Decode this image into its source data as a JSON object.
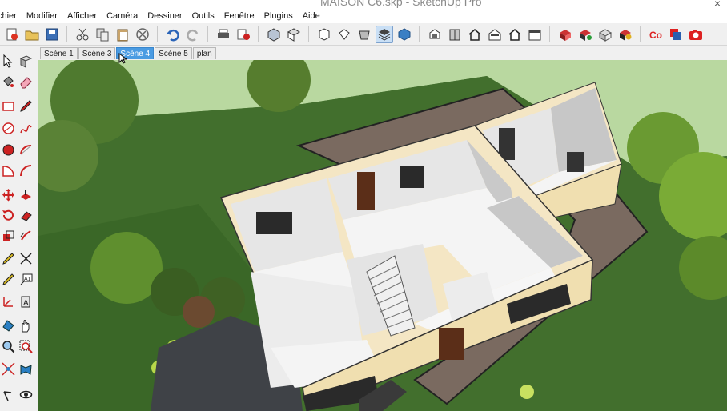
{
  "window": {
    "title": "MAISON C6.skp - SketchUp Pro",
    "close_glyph": "×"
  },
  "menu": [
    {
      "label": "chier"
    },
    {
      "label": "Modifier"
    },
    {
      "label": "Afficher"
    },
    {
      "label": "Caméra"
    },
    {
      "label": "Dessiner"
    },
    {
      "label": "Outils"
    },
    {
      "label": "Fenêtre"
    },
    {
      "label": "Plugins"
    },
    {
      "label": "Aide"
    }
  ],
  "scenes": {
    "tabs": [
      {
        "label": "Scène 1",
        "active": false
      },
      {
        "label": "Scène 3",
        "active": false
      },
      {
        "label": "Scène 4",
        "active": true
      },
      {
        "label": "Scène 5",
        "active": false
      },
      {
        "label": "plan",
        "active": false
      }
    ]
  },
  "toolbar_icons": [
    "new-model-icon",
    "open-icon",
    "save-icon",
    "cut-icon",
    "copy-icon",
    "paste-icon",
    "erase-icon",
    "undo-icon",
    "redo-icon",
    "print-icon",
    "model-info-icon",
    "iso-view-icon",
    "top-view-icon",
    "front-view-icon",
    "right-view-icon",
    "back-view-icon",
    "left-view-icon",
    "bottom-view-icon",
    "xray-icon",
    "wireframe-icon",
    "hidden-line-icon",
    "shaded-icon",
    "shaded-texture-icon",
    "monochrome-icon",
    "warehouse-icon",
    "share-model-icon",
    "components-icon",
    "extension-icon",
    "ruby-icon",
    "layout-icon",
    "screenshot-icon"
  ],
  "viewport": {
    "description_free": true,
    "colors": {
      "sky": "#b9d8a0",
      "grass": "#3f6b2a",
      "gravel": "#7a6a60",
      "wall_top": "#f4e6c4",
      "floor": "#f4f4f4",
      "inner_wall": "#e6e6e6",
      "outer_wall": "#f0dfb0",
      "path": "#3f4247"
    }
  }
}
